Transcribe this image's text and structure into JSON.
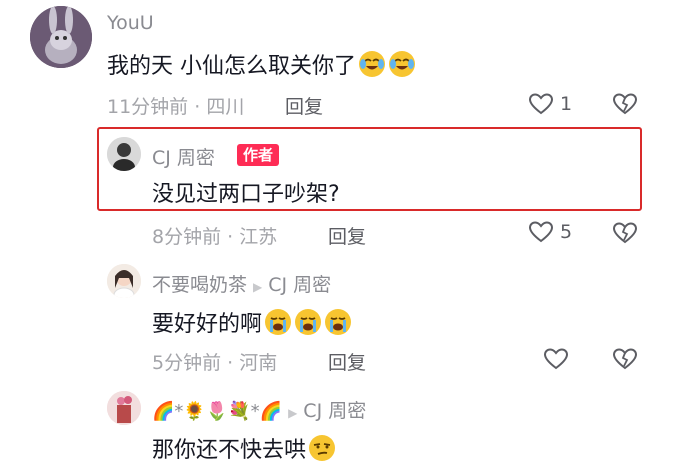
{
  "comments": [
    {
      "author": "YouU",
      "text": "我的天 小仙怎么取关你了",
      "time": "11分钟前",
      "location": "四川",
      "reply_label": "回复",
      "likes": "1"
    },
    {
      "author": "CJ 周密",
      "badge": "作者",
      "text": "没见过两口子吵架?",
      "time": "8分钟前",
      "location": "江苏",
      "reply_label": "回复",
      "likes": "5"
    },
    {
      "author": "不要喝奶茶",
      "reply_to": "CJ 周密",
      "text": "要好好的啊",
      "time": "5分钟前",
      "location": "河南",
      "reply_label": "回复",
      "likes": ""
    },
    {
      "author_emoji": "🌈*🌻🌷💐*🌈",
      "reply_to": "CJ 周密",
      "text": "那你还不快去哄"
    }
  ],
  "separator": "·",
  "colors": {
    "highlight_border": "#d92a2a",
    "author_badge": "#fe2c55"
  },
  "icons": [
    "heart-outline-icon",
    "broken-heart-icon",
    "reply-arrow-icon",
    "crying-laughing-emoji",
    "loudly-crying-emoji",
    "smirk-emoji"
  ]
}
